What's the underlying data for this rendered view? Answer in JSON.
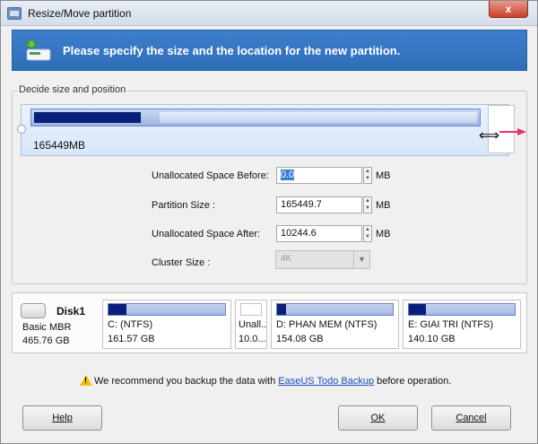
{
  "window": {
    "title": "Resize/Move partition",
    "close_label": "x"
  },
  "banner": {
    "text": "Please specify the size and the location for the new partition."
  },
  "group": {
    "label": "Decide size and position"
  },
  "slider": {
    "size_label": "165449MB",
    "used_fraction": 0.24,
    "partition_fraction": 0.942
  },
  "form": {
    "unallocated_before": {
      "label": "Unallocated Space Before:",
      "value": "0.0",
      "unit": "MB"
    },
    "partition_size": {
      "label": "Partition Size :",
      "value": "165449.7",
      "unit": "MB"
    },
    "unallocated_after": {
      "label": "Unallocated Space After:",
      "value": "10244.6",
      "unit": "MB"
    },
    "cluster_size": {
      "label": "Cluster Size :",
      "value": "4K"
    }
  },
  "disk": {
    "name": "Disk1",
    "type": "Basic MBR",
    "size": "465.76 GB",
    "partitions": [
      {
        "name": "C: (NTFS)",
        "size": "161.57 GB",
        "used_fraction": 0.15
      },
      {
        "name": "Unall...",
        "size": "10.0...",
        "used_fraction": 0
      },
      {
        "name": "D: PHAN MEM  (NTFS)",
        "size": "154.08 GB",
        "used_fraction": 0.08
      },
      {
        "name": "E: GIAI TRI (NTFS)",
        "size": "140.10 GB",
        "used_fraction": 0.16
      }
    ]
  },
  "notice": {
    "prefix": "We recommend you backup the data with ",
    "link": "EaseUS Todo Backup",
    "suffix": " before operation."
  },
  "buttons": {
    "help": "Help",
    "ok": "OK",
    "cancel": "Cancel"
  },
  "colors": {
    "banner": "#2f6db8",
    "used_bar": "#0a1f7a",
    "arrow": "#e8336b"
  }
}
